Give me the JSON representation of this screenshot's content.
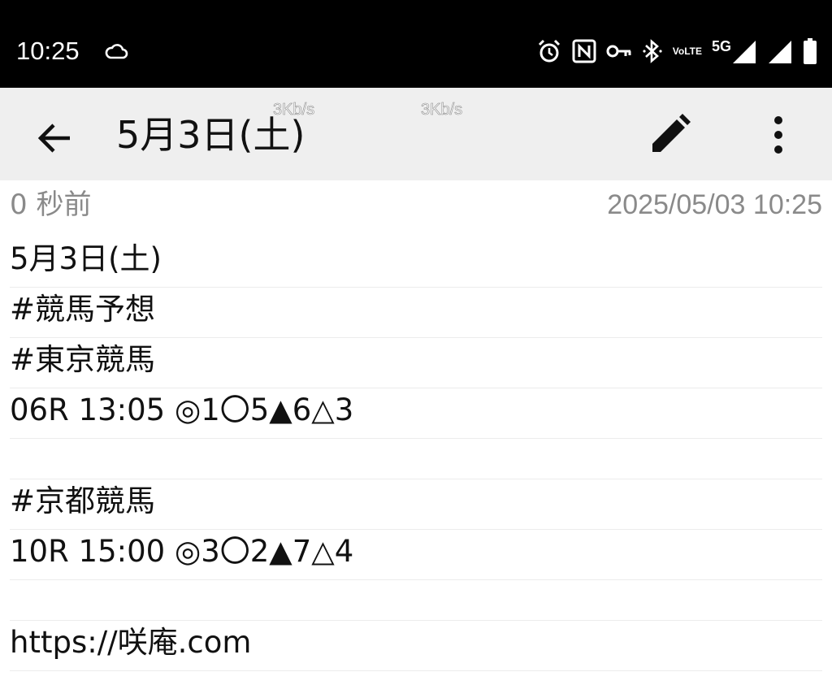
{
  "status_bar": {
    "time": "10:25",
    "network": "5G",
    "volte": [
      "Vo",
      "LTE"
    ],
    "icons": [
      "cloud-icon",
      "alarm-icon",
      "nfc-icon",
      "vpn-key-icon",
      "bluetooth-icon",
      "volte-icon",
      "signal-icon",
      "signal-icon",
      "battery-icon"
    ]
  },
  "app_bar": {
    "title": "5月3日(土)",
    "speed_1": "3Kb/s",
    "speed_2": "3Kb/s",
    "icons": [
      "back-arrow-icon",
      "pencil-icon",
      "more-vert-icon"
    ]
  },
  "meta": {
    "relative_time": "0 秒前",
    "timestamp": "2025/05/03 10:25"
  },
  "note": {
    "lines": [
      "5月3日(土)",
      "#競馬予想",
      "#東京競馬",
      "06R 13:05 ◎1〇5▲6△3",
      "",
      "#京都競馬",
      "10R 15:00 ◎3〇2▲7△4",
      "",
      "https://咲庵.com"
    ]
  },
  "colors": {
    "status_bar_bg": "#000000",
    "app_bar_bg": "#efefef",
    "meta_text": "#8a8a8a",
    "rule_line": "#ececec"
  }
}
